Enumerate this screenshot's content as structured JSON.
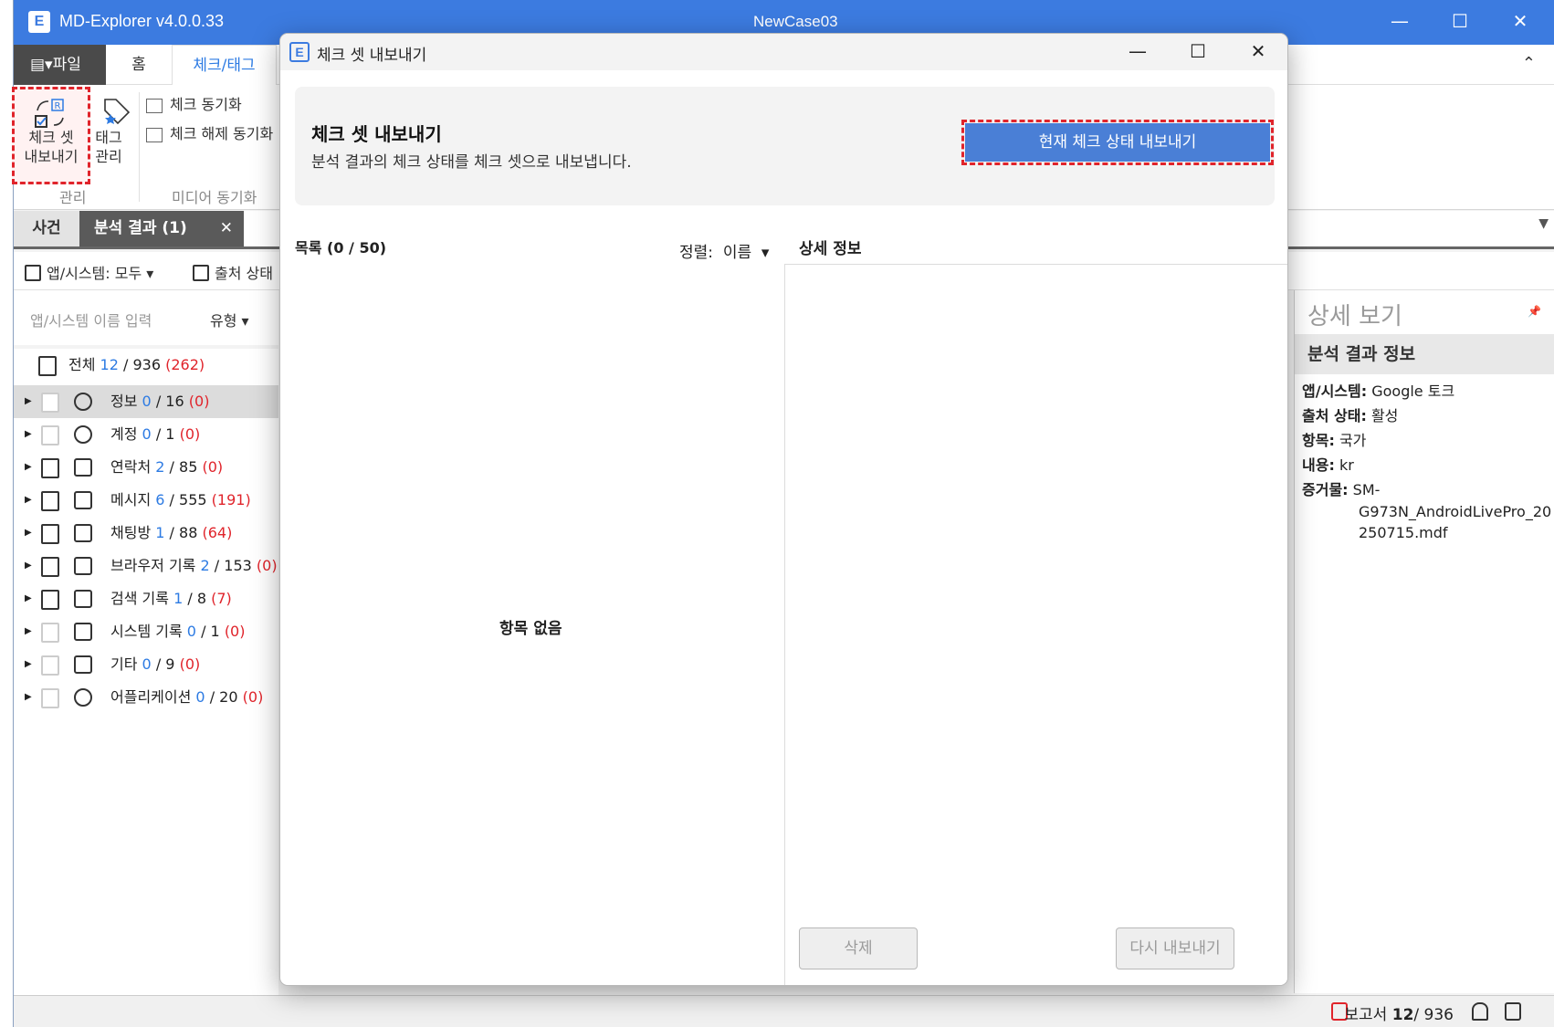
{
  "app": {
    "logo": "E",
    "title": "MD-Explorer v4.0.0.33",
    "case_name": "NewCase03",
    "window_controls": {
      "minimize": "—",
      "maximize": "☐",
      "close": "✕"
    }
  },
  "ribbon": {
    "tabs": {
      "file": "▤▾파일",
      "home": "홈",
      "check_tag": "체크/태그"
    },
    "collapse": "⌃",
    "check_set_export": {
      "line1": "체크 셋",
      "line2": "내보내기"
    },
    "tag_manage": {
      "line1": "태그",
      "line2": "관리"
    },
    "check_sync": "체크 동기화",
    "uncheck_sync": "체크 해제 동기화",
    "group_manage": "관리",
    "group_media_sync": "미디어 동기화"
  },
  "doc_tabs": {
    "case": "사건",
    "results": "분석 결과 (1)",
    "close": "✕",
    "menu": "▼"
  },
  "toolbar": {
    "app_system": "앱/시스템: 모두",
    "source_state": "출처 상태"
  },
  "filter": {
    "placeholder": "앱/시스템 이름 입력",
    "type": "유형"
  },
  "tree": {
    "total": {
      "label": "전체",
      "checked": "12",
      "total": "/ 936",
      "flagged": "(262)"
    },
    "items": [
      {
        "label": "정보",
        "checked": "0",
        "total": "/ 16",
        "flagged": "(0)",
        "icon": "info-icon"
      },
      {
        "label": "계정",
        "checked": "0",
        "total": "/ 1",
        "flagged": "(0)",
        "icon": "account-icon"
      },
      {
        "label": "연락처",
        "checked": "2",
        "total": "/ 85",
        "flagged": "(0)",
        "icon": "contacts-icon"
      },
      {
        "label": "메시지",
        "checked": "6",
        "total": "/ 555",
        "flagged": "(191)",
        "icon": "message-icon"
      },
      {
        "label": "채팅방",
        "checked": "1",
        "total": "/ 88",
        "flagged": "(64)",
        "icon": "chatroom-icon"
      },
      {
        "label": "브라우저 기록",
        "checked": "2",
        "total": "/ 153",
        "flagged": "(0)",
        "icon": "browser-history-icon"
      },
      {
        "label": "검색 기록",
        "checked": "1",
        "total": "/ 8",
        "flagged": "(7)",
        "icon": "search-history-icon"
      },
      {
        "label": "시스템 기록",
        "checked": "0",
        "total": "/ 1",
        "flagged": "(0)",
        "icon": "system-log-icon"
      },
      {
        "label": "기타",
        "checked": "0",
        "total": "/ 9",
        "flagged": "(0)",
        "icon": "other-icon"
      },
      {
        "label": "어플리케이션",
        "checked": "0",
        "total": "/ 20",
        "flagged": "(0)",
        "icon": "application-icon"
      }
    ]
  },
  "side_panel": {
    "title": "상세 보기",
    "pin": "📌",
    "section": "분석 결과 정보",
    "rows": [
      {
        "key": "앱/시스템:",
        "value": "Google 토크"
      },
      {
        "key": "출처 상태:",
        "value": "활성"
      },
      {
        "key": "항목:",
        "value": "국가"
      },
      {
        "key": "내용:",
        "value": "kr"
      },
      {
        "key": "증거물:",
        "value": "SM-"
      }
    ],
    "evidence_cont1": "G973N_AndroidLivePro_20",
    "evidence_cont2": "250715.mdf"
  },
  "statusbar": {
    "report_label": "보고서",
    "report_checked": "12",
    "report_total": "/ 936"
  },
  "dialog": {
    "logo": "E",
    "title": "체크 셋 내보내기",
    "banner_title": "체크 셋 내보내기",
    "banner_desc": "분석 결과의 체크 상태를 체크 셋으로 내보냅니다.",
    "export_button": "현재 체크 상태 내보내기",
    "list_title": "목록 (0 / 50)",
    "sort_label": "정렬:",
    "sort_value": "이름",
    "detail_title": "상세 정보",
    "empty": "항목 없음",
    "delete_button": "삭제",
    "reexport_button": "다시 내보내기"
  },
  "colors": {
    "accent": "#3c7be0",
    "highlight": "#e0242b",
    "checked": "#2d7be3",
    "flagged": "#e0242b"
  }
}
